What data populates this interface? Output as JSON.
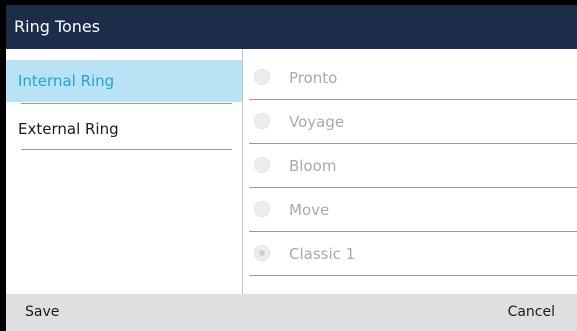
{
  "header": {
    "title": "Ring Tones"
  },
  "left_menu": {
    "items": [
      {
        "label": "Internal Ring",
        "selected": true
      },
      {
        "label": "External Ring",
        "selected": false
      }
    ]
  },
  "ring_options": {
    "items": [
      {
        "label": "Pronto",
        "checked": false
      },
      {
        "label": "Voyage",
        "checked": false
      },
      {
        "label": "Bloom",
        "checked": false
      },
      {
        "label": "Move",
        "checked": false
      },
      {
        "label": "Classic 1",
        "checked": true
      }
    ]
  },
  "softkeys": {
    "save_label": "Save",
    "cancel_label": "Cancel"
  },
  "colors": {
    "titlebar": "#1c2d4a",
    "selected_bg": "#b9e3f5",
    "selected_text": "#1ea4dc",
    "softkey_bar": "#dedfe1",
    "disabled_text": "#a9a9a9"
  }
}
